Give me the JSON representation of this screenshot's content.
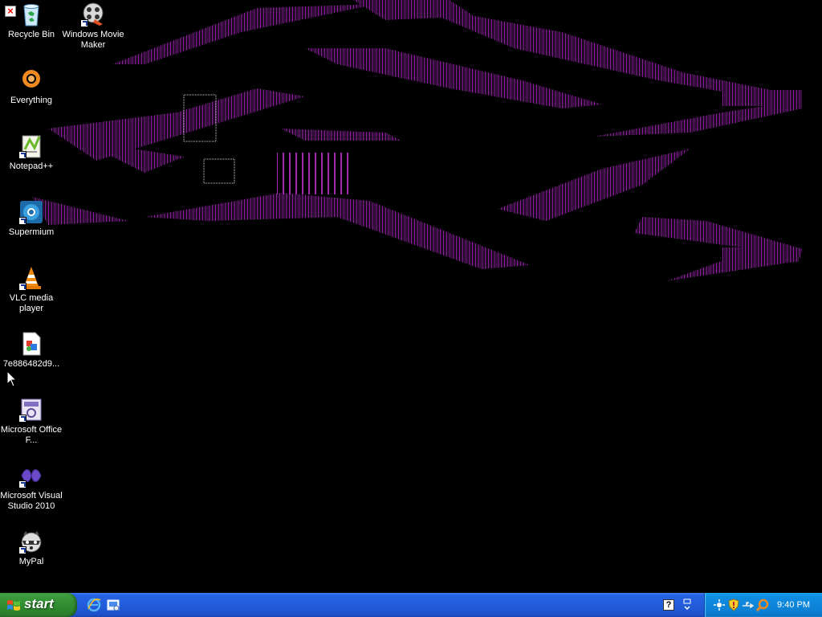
{
  "desktop": {
    "icons": [
      {
        "label": "Recycle Bin",
        "icon": "recycle-bin-icon"
      },
      {
        "label": "Windows Movie Maker",
        "icon": "movie-maker-icon"
      },
      {
        "label": "Everything",
        "icon": "everything-search-icon"
      },
      {
        "label": "Notepad++",
        "icon": "notepad-plus-plus-icon"
      },
      {
        "label": "Supermium",
        "icon": "supermium-browser-icon"
      },
      {
        "label": "VLC media player",
        "icon": "vlc-cone-icon"
      },
      {
        "label": "7e886482d9...",
        "icon": "image-file-icon"
      },
      {
        "label": "Microsoft Office F...",
        "icon": "office-app-icon"
      },
      {
        "label": "Microsoft Visual Studio 2010",
        "icon": "visual-studio-icon"
      },
      {
        "label": "MyPal",
        "icon": "mypal-raccoon-icon"
      }
    ]
  },
  "taskbar": {
    "start_label": "start",
    "quick_launch": [
      "internet-explorer-icon",
      "show-desktop-icon"
    ],
    "tray": {
      "clock": "9:40 PM",
      "icons": [
        "network-icon",
        "security-shield-icon",
        "usb-icon",
        "search-icon"
      ]
    },
    "colors": {
      "taskbar_blue": "#235ddc",
      "start_green": "#2f8a2f",
      "tray_blue": "#0c7fd4"
    }
  }
}
